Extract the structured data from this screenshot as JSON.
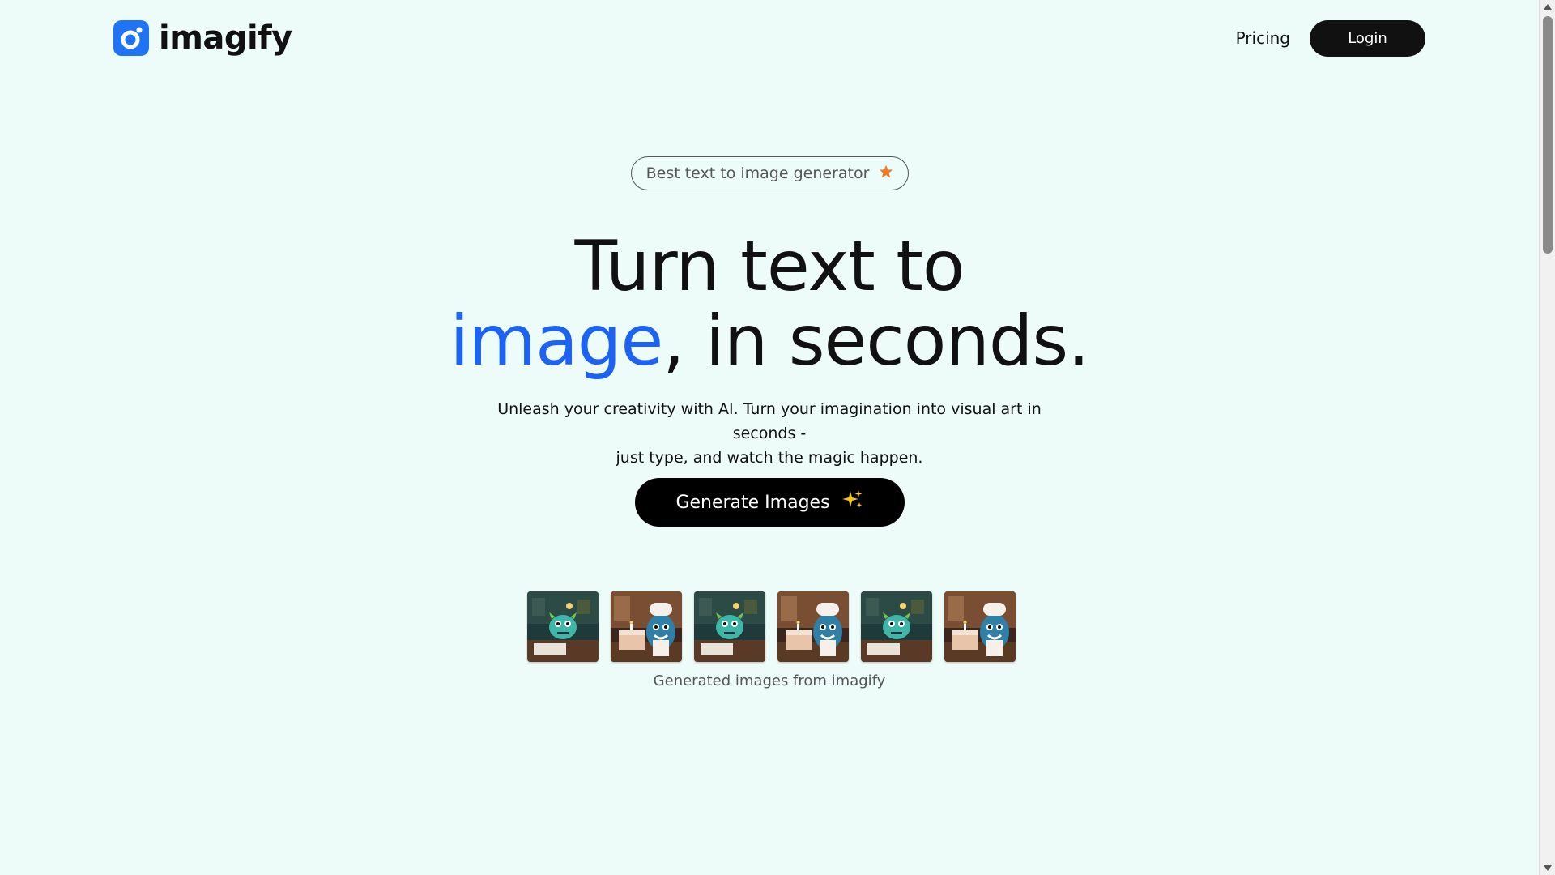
{
  "header": {
    "logo_text": "imagify",
    "nav": {
      "pricing_label": "Pricing",
      "login_label": "Login"
    }
  },
  "hero": {
    "badge_text": "Best text to image generator",
    "badge_icon": "star-icon",
    "headline_line1": "Turn text to",
    "headline_accent": "image",
    "headline_rest": ", in seconds.",
    "subtitle_line1": "Unleash your creativity with AI. Turn your imagination into visual art in seconds -",
    "subtitle_line2": "just type, and watch the magic happen.",
    "cta_label": "Generate Images",
    "cta_icon": "sparkles-icon"
  },
  "gallery": {
    "caption": "Generated images from imagify",
    "items": [
      {
        "name": "green-monster-at-desk"
      },
      {
        "name": "blue-monster-with-cake"
      },
      {
        "name": "green-monster-at-desk"
      },
      {
        "name": "blue-monster-with-cake"
      },
      {
        "name": "green-monster-at-desk"
      },
      {
        "name": "blue-monster-with-cake"
      }
    ]
  },
  "colors": {
    "background": "#eefcf9",
    "accent": "#1b63f0",
    "logo_blue": "#1f74f6",
    "button_dark": "#111111",
    "badge_star": "#f07a2a",
    "sparkle": "#f5c518"
  }
}
